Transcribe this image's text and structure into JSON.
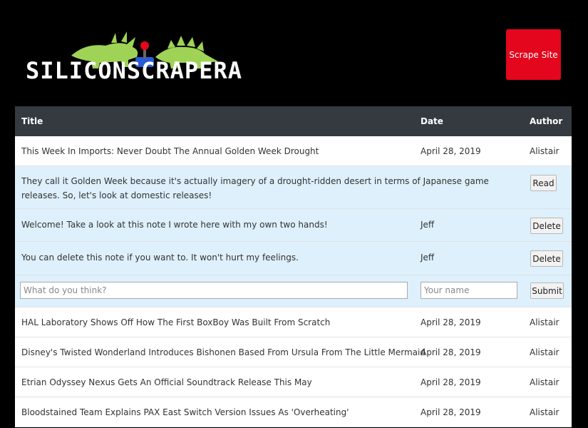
{
  "header": {
    "brand": "SILICONSCRAPERA",
    "scrape_button": "Scrape Site"
  },
  "table": {
    "headers": {
      "title": "Title",
      "date": "Date",
      "author": "Author"
    }
  },
  "article": {
    "title": "This Week In Imports: Never Doubt The Annual Golden Week Drought",
    "date": "April 28, 2019",
    "author": "Alistair",
    "summary": "They call it Golden Week because it's actually imagery of a drought-ridden desert in terms of Japanese game releases. So, let's look at domestic releases!",
    "read_label": "Read",
    "notes": [
      {
        "text": "Welcome! Take a look at this note I wrote here with my own two hands!",
        "author": "Jeff",
        "delete_label": "Delete"
      },
      {
        "text": "You can delete this note if you want to. It won't hurt my feelings.",
        "author": "Jeff",
        "delete_label": "Delete"
      }
    ],
    "form": {
      "note_placeholder": "What do you think?",
      "name_placeholder": "Your name",
      "submit_label": "Submit"
    }
  },
  "rows": [
    {
      "title": "HAL Laboratory Shows Off How The First BoxBoy Was Built From Scratch",
      "date": "April 28, 2019",
      "author": "Alistair"
    },
    {
      "title": "Disney's Twisted Wonderland Introduces Bishonen Based From Ursula From The Little Mermaid",
      "date": "April 28, 2019",
      "author": "Alistair"
    },
    {
      "title": "Etrian Odyssey Nexus Gets An Official Soundtrack Release This May",
      "date": "April 28, 2019",
      "author": "Alistair"
    },
    {
      "title": "Bloodstained Team Explains PAX East Switch Version Issues As 'Overheating'",
      "date": "April 28, 2019",
      "author": "Alistair"
    }
  ],
  "colors": {
    "accent": "#e3061c",
    "header_bg": "#343a40",
    "highlight": "#ddf0fb",
    "dino_green": "#9fd356"
  }
}
